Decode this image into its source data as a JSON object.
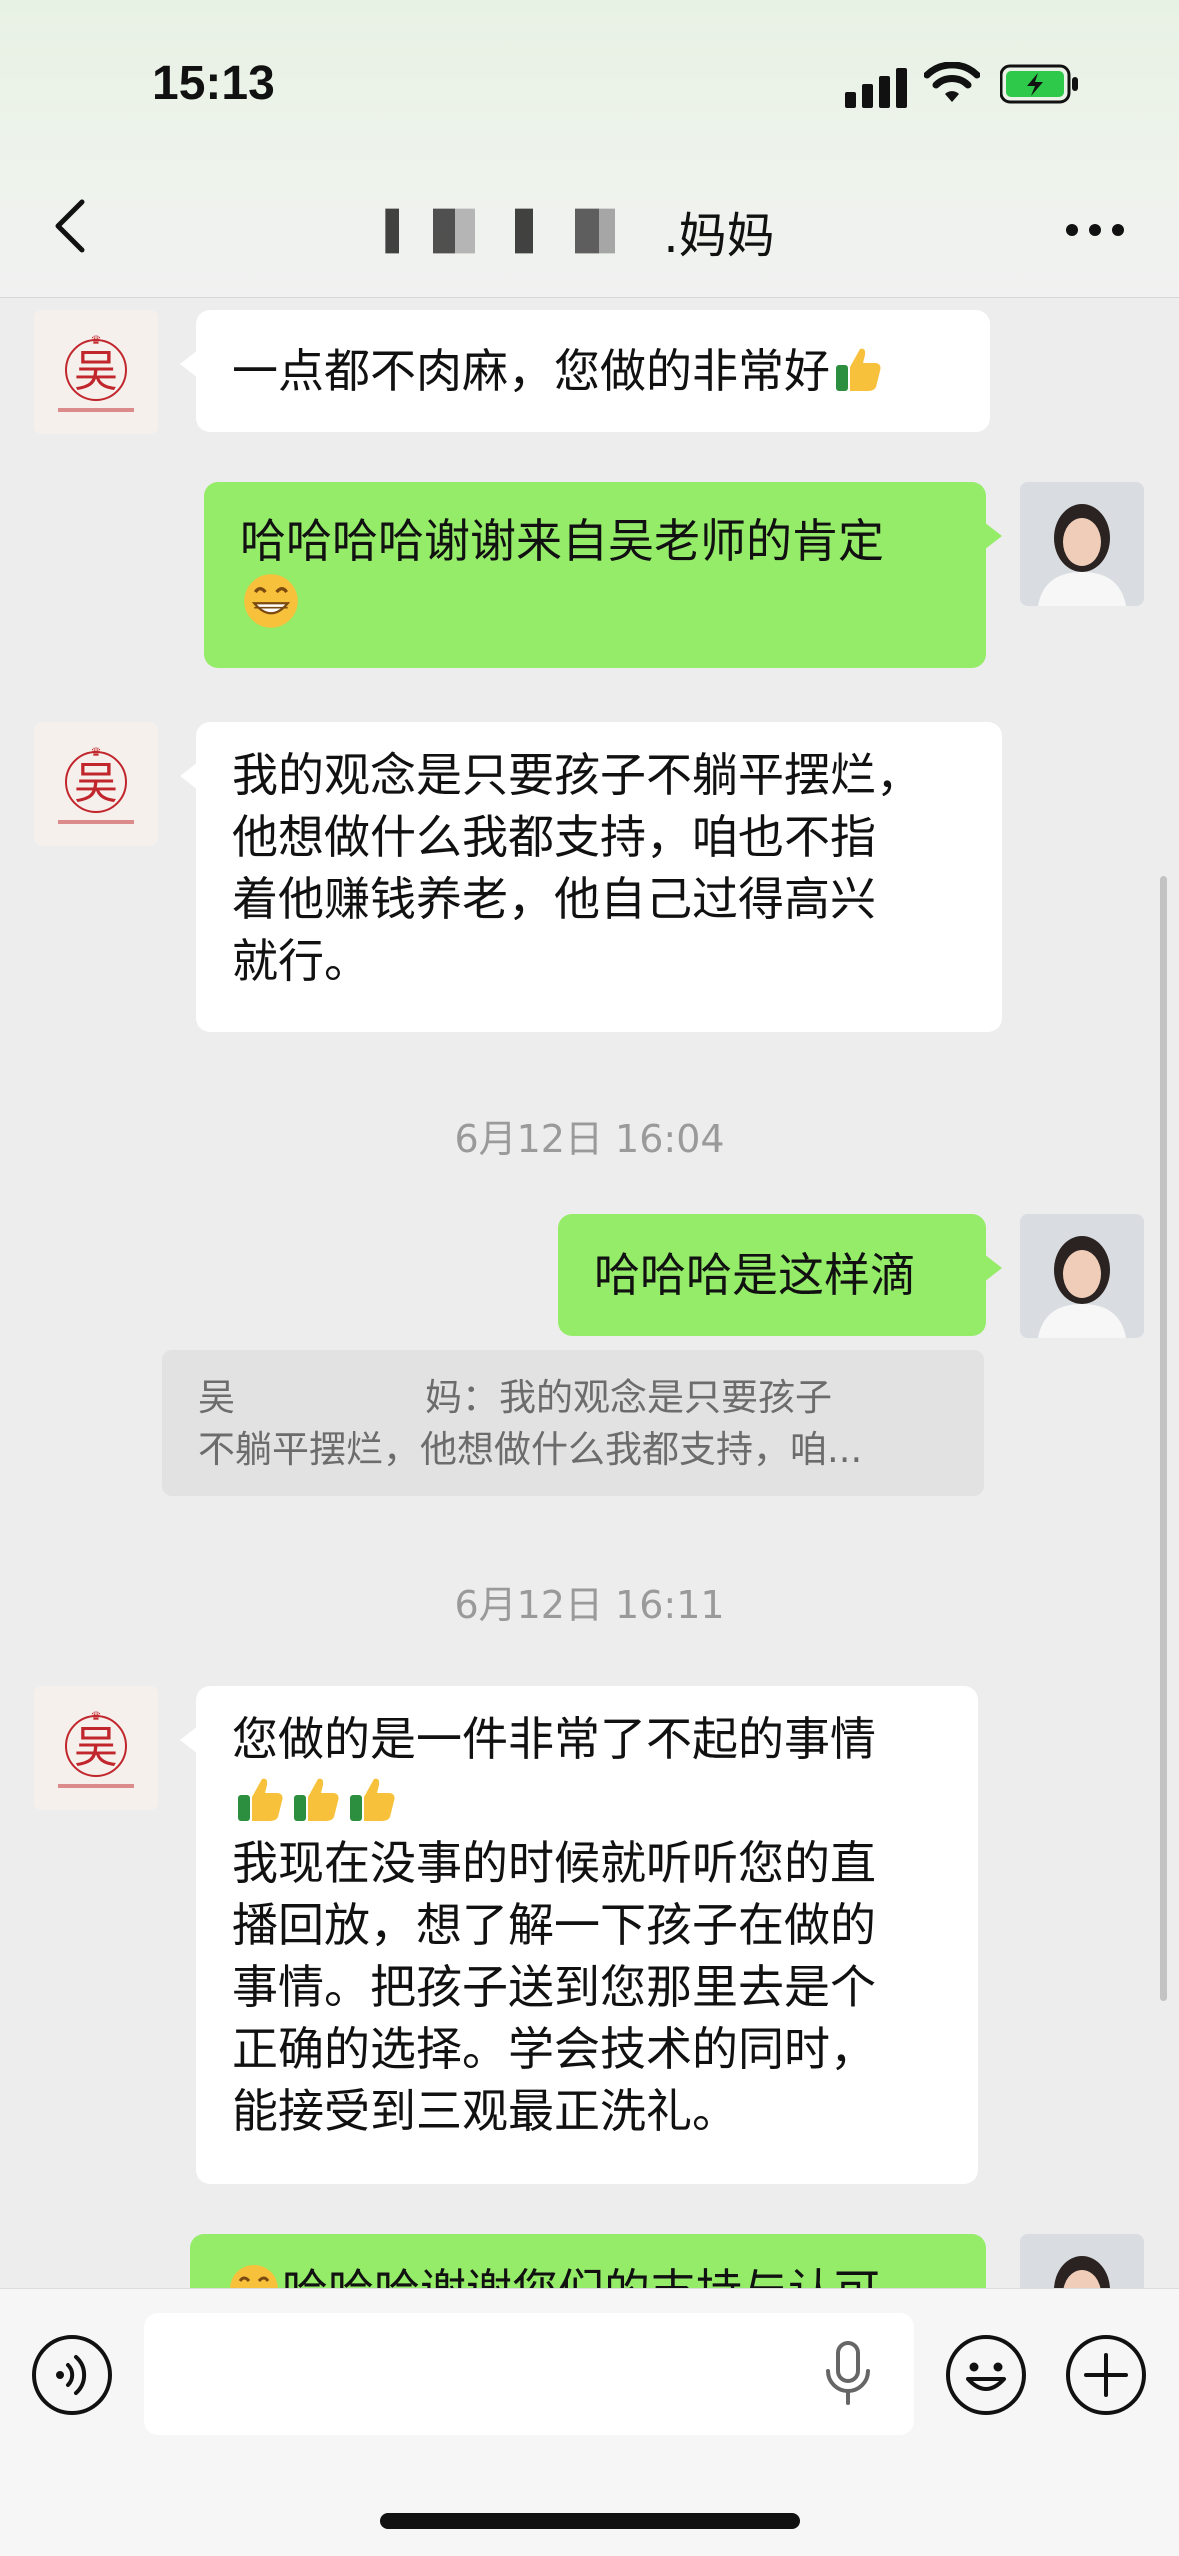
{
  "status_bar": {
    "time": "15:13"
  },
  "header": {
    "title_suffix": ".妈妈"
  },
  "messages": [
    {
      "text": "一点都不肉麻，您做的非常好"
    },
    {
      "text_line1": "哈哈哈哈谢谢来自吴老师的肯定"
    },
    {
      "lines": [
        "我的观念是只要孩子不躺平摆烂，",
        "他想做什么我都支持，咱也不指",
        "着他赚钱养老，他自己过得高兴",
        "就行。"
      ]
    },
    {
      "text": "哈哈哈是这样滴"
    },
    {
      "lines": [
        "您做的是一件非常了不起的事情",
        "我现在没事的时候就听听您的直",
        "播回放，想了解一下孩子在做的",
        "事情。把孩子送到您那里去是个",
        "正确的选择。学会技术的同时，",
        "能接受到三观最正洗礼。"
      ]
    },
    {
      "text": "哈哈哈谢谢您们的支持与认可"
    }
  ],
  "timestamps": [
    "6月12日 16:04",
    "6月12日 16:11"
  ],
  "quote": {
    "sender_start": "吴",
    "sender_end": "妈：",
    "line1_rest": "我的观念是只要孩子",
    "line2": "不躺平摆烂，他想做什么我都支持，咱..."
  },
  "avatar_logo_text": "吴",
  "input": {
    "placeholder": ""
  },
  "icons": {
    "back": "chevron-left-icon",
    "more": "more-icon",
    "voice": "voice-icon",
    "mic": "mic-icon",
    "emoji": "emoji-face-icon",
    "plus": "plus-icon",
    "thumbs_up": "thumbs-up-emoji",
    "grin": "grin-emoji"
  },
  "colors": {
    "bubble_self": "#95ec69",
    "bubble_other": "#ffffff",
    "background": "#ededed",
    "battery": "#2ec84a",
    "logo_red": "#c0262c"
  }
}
